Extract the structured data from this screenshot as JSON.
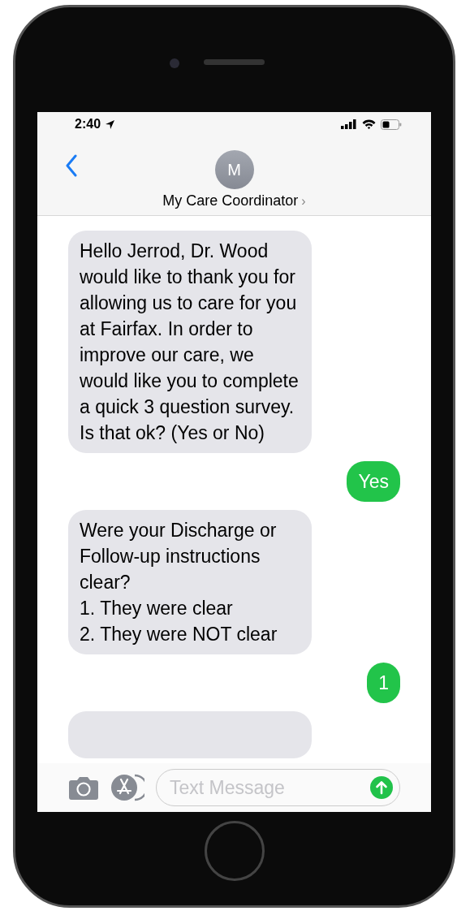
{
  "status_bar": {
    "time": "2:40"
  },
  "header": {
    "avatar_initial": "M",
    "contact_name": "My Care Coordinator",
    "chevron": "›"
  },
  "messages": [
    {
      "kind": "incoming",
      "text": "Hello Jerrod, Dr. Wood would like to thank you for allowing us to care for you at Fairfax. In order to improve our care, we would like you to complete a quick 3 question survey. Is that ok? (Yes or No)"
    },
    {
      "kind": "outgoing",
      "text": "Yes"
    },
    {
      "kind": "incoming",
      "text": "Were your Discharge or Follow-up instructions clear?\n1. They were clear\n2. They were NOT clear"
    },
    {
      "kind": "outgoing",
      "text": "1"
    },
    {
      "kind": "incoming"
    }
  ],
  "composer": {
    "placeholder": "Text Message"
  }
}
